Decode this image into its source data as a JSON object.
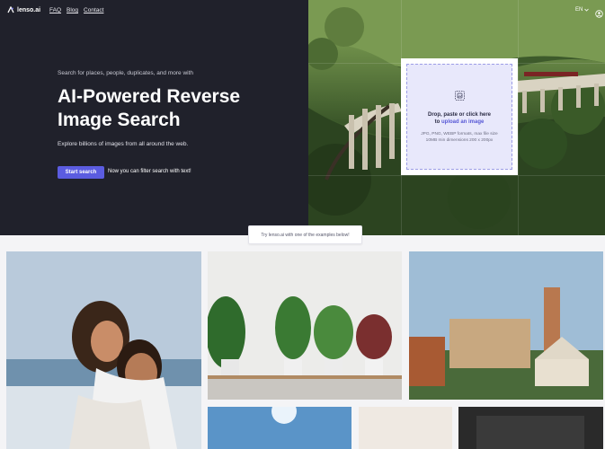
{
  "brand": {
    "name": "lenso.ai"
  },
  "nav": {
    "faq": "FAQ",
    "blog": "Blog",
    "contact": "Contact",
    "language": "EN"
  },
  "hero": {
    "subtitle": "Search for places, people, duplicates, and more with",
    "title": "AI-Powered Reverse Image Search",
    "description": "Explore billions of images from all around the web.",
    "start_button": "Start search",
    "filter_note": "Now you can filter search with text!"
  },
  "upload": {
    "prompt": "Drop, paste or click here",
    "prompt_prefix": "to",
    "link": "upload an image",
    "formats": "JPG, PNG, WEBP formats, max file size",
    "dimensions": "10MB min dimensions 200 x 200px"
  },
  "examples": {
    "tip": "Try lenso.ai with one of the examples below!",
    "tiles": [
      {
        "subject": "couple"
      },
      {
        "subject": "plants"
      },
      {
        "subject": "rome"
      },
      {
        "subject": "sky"
      },
      {
        "subject": "sand"
      },
      {
        "subject": "object"
      }
    ]
  },
  "colors": {
    "hero_bg": "#20212b",
    "accent": "#5b5ce0",
    "upload_bg": "#e8e8fb",
    "page_bg": "#f4f4f6"
  },
  "icons": {
    "logo": "lenso-logo-icon",
    "chevron": "chevron-down-icon",
    "user": "user-circle-icon",
    "upload": "image-upload-icon"
  }
}
